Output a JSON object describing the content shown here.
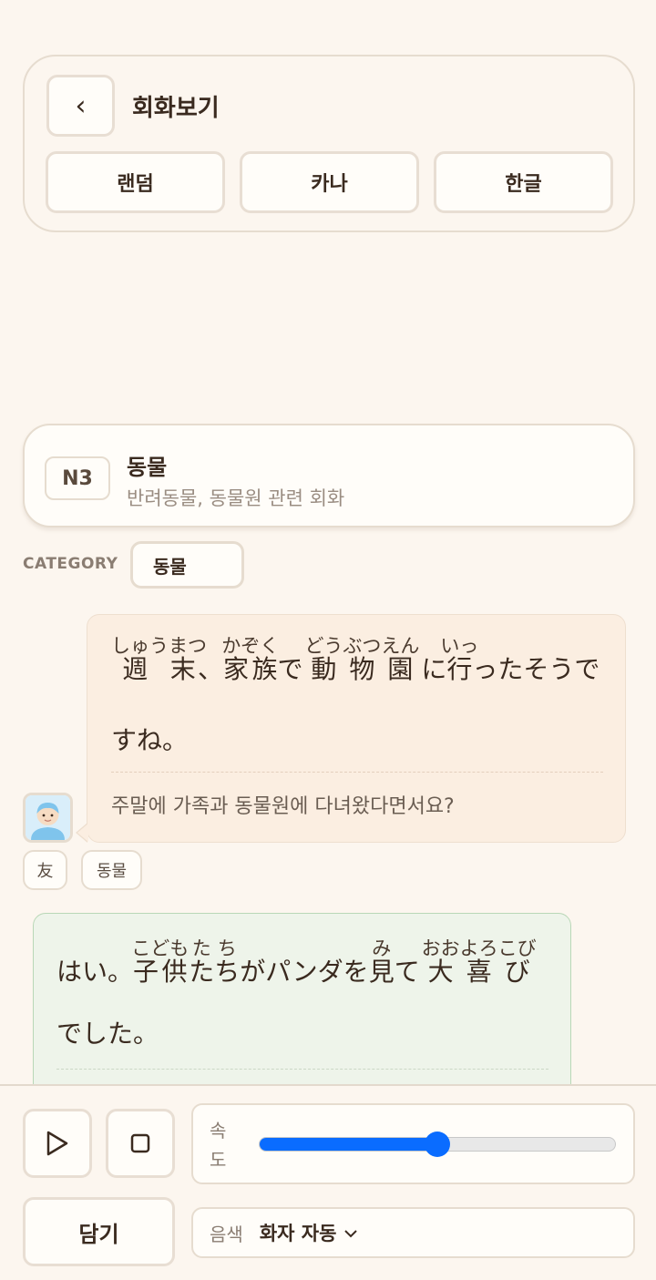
{
  "header": {
    "back_icon": "‹",
    "title": "회화보기",
    "modes": [
      "랜덤",
      "카나",
      "한글"
    ]
  },
  "topic": {
    "level": "N3",
    "title": "동물",
    "description": "반려동물, 동물원 관련 회화"
  },
  "category": {
    "label": "CATEGORY",
    "value": "동물"
  },
  "messages": [
    {
      "speaker_icon": "child-avatar-icon",
      "line1_parts": [
        {
          "text": "週末",
          "ruby": "しゅうまつ"
        },
        {
          "text": "、",
          "ruby": ""
        },
        {
          "text": "家族",
          "ruby": "かぞく"
        },
        {
          "text": "で ",
          "ruby": ""
        },
        {
          "text": "動物園",
          "ruby": "どうぶつえん"
        },
        {
          "text": " に",
          "ruby": ""
        },
        {
          "text": "行",
          "ruby": "いっ"
        },
        {
          "text": "ったそうで",
          "ruby": ""
        }
      ],
      "line2": "すね。",
      "translation": "주말에 가족과 동물원에 다녀왔다면서요?",
      "tags": [
        "友",
        "동물"
      ]
    },
    {
      "line1_parts": [
        {
          "text": "はい。",
          "ruby": ""
        },
        {
          "text": "子供",
          "ruby": "こども"
        },
        {
          "text": "たち",
          "ruby": "たち"
        },
        {
          "text": "がパンダを",
          "ruby": ""
        },
        {
          "text": "見",
          "ruby": "み"
        },
        {
          "text": "て ",
          "ruby": ""
        },
        {
          "text": "大喜び",
          "ruby": "おおよろこび"
        }
      ],
      "line2": "でした。"
    }
  ],
  "player": {
    "play_icon": "play-icon",
    "stop_icon": "stop-icon",
    "speed_label": "속도",
    "speed_fraction": 0.5,
    "save_label": "담기",
    "voice_label": "음색",
    "voice_value": "화자 자동",
    "accent_color": "#0a6cff"
  }
}
